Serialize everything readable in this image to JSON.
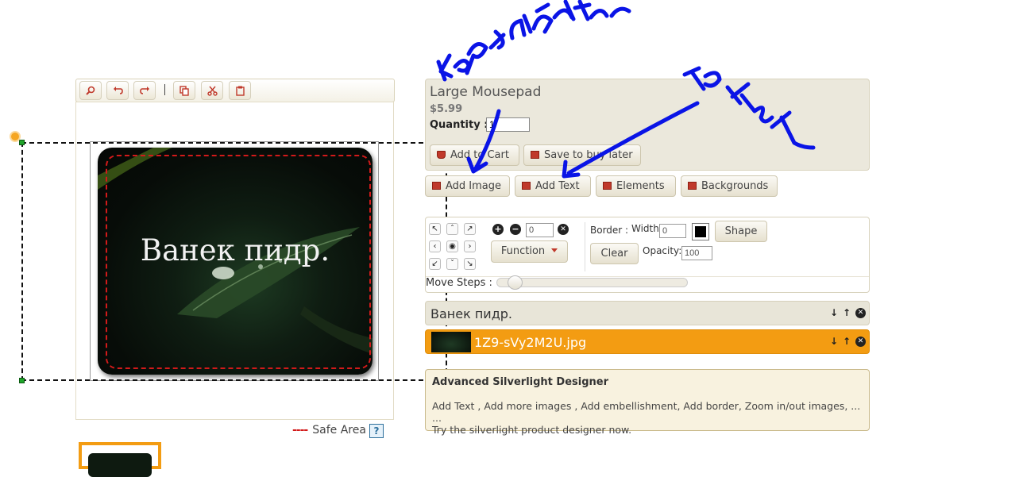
{
  "designer": {
    "toolbar": {
      "tools": [
        "zoom-icon",
        "undo-icon",
        "redo-icon",
        "copy-icon",
        "cut-icon",
        "paste-icon"
      ]
    },
    "canvas": {
      "product_text": "Ванек пидр."
    },
    "safe_area": {
      "label": "Safe Area",
      "help": "?"
    }
  },
  "product": {
    "name": "Large Mousepad",
    "price": "$5.99",
    "quantity_label": "Quantity :",
    "quantity_value": "1",
    "add_to_cart": "Add to Cart",
    "save_to_buy_later": "Save to buy later"
  },
  "actions": {
    "add_image": "Add Image",
    "add_text": "Add Text",
    "elements": "Elements",
    "backgrounds": "Backgrounds"
  },
  "controls": {
    "rotate_value": "0",
    "function_label": "Function",
    "border_label": "Border :",
    "width_label": "Width",
    "width_value": "0",
    "shape_label": "Shape",
    "clear_label": "Clear",
    "opacity_label": "Opacity:",
    "opacity_value": "100",
    "move_steps_label": "Move Steps :"
  },
  "layers": [
    {
      "label": "Ванек пидр.",
      "active": false
    },
    {
      "label": "1Z9-sVy2M2U.jpg",
      "active": true
    }
  ],
  "info": {
    "title": "Advanced Silverlight Designer",
    "line1": "Add Text , Add more images , Add embellishment, Add border, Zoom in/out images, ... ...",
    "line2": "Try the silverlight product designer now."
  },
  "annotations": {
    "left_word": "картинка",
    "right_word": "текст",
    "ink_color": "#0a14e6"
  },
  "colors": {
    "accent": "#f39c12",
    "safe_line": "#d21a1a",
    "handle": "#1fa52a"
  }
}
